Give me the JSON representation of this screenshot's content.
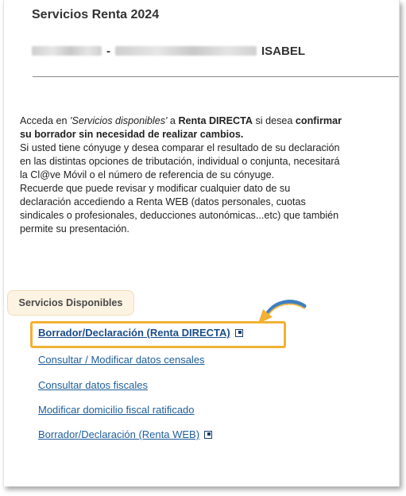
{
  "header": {
    "title": "Servicios Renta 2024",
    "name_separator": "-",
    "name_suffix": "ISABEL"
  },
  "description": {
    "p1_prefix": "Acceda en ",
    "p1_italic": "'Servicios disponibles'",
    "p1_mid": " a ",
    "p1_bold1": "Renta DIRECTA",
    "p1_mid2": " si desea ",
    "p1_bold2": "confirmar su borrador sin necesidad de realizar cambios.",
    "p2": "Si usted tiene cónyuge y desea comparar el resultado de su declaración en las distintas opciones de tributación, individual o conjunta, necesitará la Cl@ve Móvil o el número de referencia de su cónyuge.",
    "p3": "Recuerde que puede revisar y modificar cualquier dato de su declaración accediendo a Renta WEB (datos personales, cuotas sindicales o profesionales, deducciones autonómicas...etc) que también permite su presentación."
  },
  "section": {
    "label": "Servicios Disponibles"
  },
  "services": [
    {
      "label": "Borrador/Declaración (Renta DIRECTA)",
      "external": true
    },
    {
      "label": "Consultar / Modificar datos censales",
      "external": false
    },
    {
      "label": "Consultar datos fiscales",
      "external": false
    },
    {
      "label": "Modificar domicilio fiscal ratificado",
      "external": false
    },
    {
      "label": "Borrador/Declaración (Renta WEB)",
      "external": true
    }
  ],
  "colors": {
    "link": "#1f5f9a",
    "highlight": "#f2b134",
    "arrow": "#3f7fc0",
    "section_bg": "#fdf3e3"
  },
  "icons": {
    "external_link": "external-link-icon",
    "pointer_arrow": "curved-arrow-icon"
  }
}
